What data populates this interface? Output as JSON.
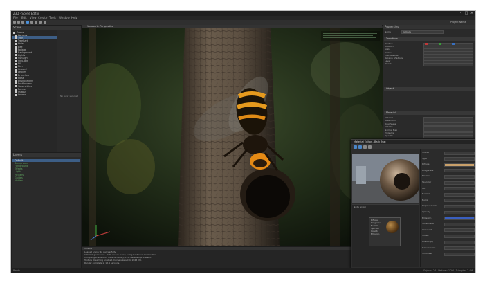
{
  "window": {
    "title": "Z3D - Scene Editor",
    "minimize": "–",
    "maximize": "□",
    "close": "×"
  },
  "menu": [
    "File",
    "Edit",
    "View",
    "Create",
    "Tools",
    "Window",
    "Help"
  ],
  "toolbar": {
    "project_label": "Project Name"
  },
  "scene_panel": {
    "header": "Scene",
    "items": [
      {
        "label": "Scene",
        "selected": false
      },
      {
        "label": "Camera",
        "selected": true
      },
      {
        "label": "Tree",
        "selected": false
      },
      {
        "label": "TreeBark",
        "selected": false
      },
      {
        "label": "Hole",
        "selected": false
      },
      {
        "label": "Bee",
        "selected": false
      },
      {
        "label": "Foliage",
        "selected": false
      },
      {
        "label": "Background",
        "selected": false
      },
      {
        "label": "Lights",
        "selected": false
      },
      {
        "label": "SunLight",
        "selected": false
      },
      {
        "label": "SkyLight",
        "selected": false
      },
      {
        "label": "Fill",
        "selected": false
      },
      {
        "label": "Rim",
        "selected": false
      },
      {
        "label": "Ground",
        "selected": false
      },
      {
        "label": "Leaves",
        "selected": false
      },
      {
        "label": "Branches",
        "selected": false
      },
      {
        "label": "Moss",
        "selected": false
      },
      {
        "label": "Environment",
        "selected": false
      },
      {
        "label": "PostProcess",
        "selected": false
      },
      {
        "label": "Volumetrics",
        "selected": false
      },
      {
        "label": "Render",
        "selected": false
      },
      {
        "label": "Output",
        "selected": false
      },
      {
        "label": "Layers",
        "selected": false
      }
    ],
    "hint": "No layer selected"
  },
  "layers_panel": {
    "header": "Layers",
    "items": [
      "Default",
      "Background",
      "Foreground",
      "Effects",
      "Lights",
      "Helpers",
      "Guides",
      "Hidden"
    ]
  },
  "viewport": {
    "tab_label": "Viewport - Perspective"
  },
  "console": {
    "header": "Console",
    "lines": [
      "Loaded scene file successfully.",
      "Initializing renderer... GPU device found, using hardware acceleration.",
      "Compiling shaders for material library, 128 materials processed.",
      "Texture streaming enabled. Cache size set to 2048 MB.",
      "Render complete in 12.4 seconds."
    ]
  },
  "status": {
    "left": "Ready",
    "right": "Objects: 24 | Vertices: 1.2M | Triangles: 2.4M"
  },
  "properties": {
    "header": "Properties",
    "name_label": "Name",
    "name_value": "Camera",
    "sections": [
      "Transform",
      "Object",
      "Material"
    ],
    "rows": [
      "Position",
      "Rotation",
      "Scale",
      "Visible",
      "Cast Shadows",
      "Receive Shadows",
      "Layer",
      "Parent",
      "Material",
      "Base Color",
      "Roughness",
      "Metallic",
      "Normal Map",
      "Emissive",
      "Opacity"
    ]
  },
  "material_window": {
    "title": "Material Editor - Bark_Mat",
    "graph_label": "Node Graph",
    "node_lines": [
      "Diffuse",
      "Roughness",
      "Normal",
      "Specular",
      "Opacity",
      "Emission"
    ],
    "prop_rows": [
      "Shader",
      "Type",
      "Diffuse",
      "Roughness",
      "Metallic",
      "Specular",
      "IOR",
      "Normal",
      "Bump",
      "Displacement",
      "Opacity",
      "Emission",
      "Subsurface",
      "Clearcoat",
      "Sheen",
      "Anisotropy",
      "Transmission",
      "Thickness"
    ]
  },
  "colors": {
    "accent": "#4a8fd8",
    "panel": "#2a2a2a",
    "selection": "#3d5e86"
  }
}
